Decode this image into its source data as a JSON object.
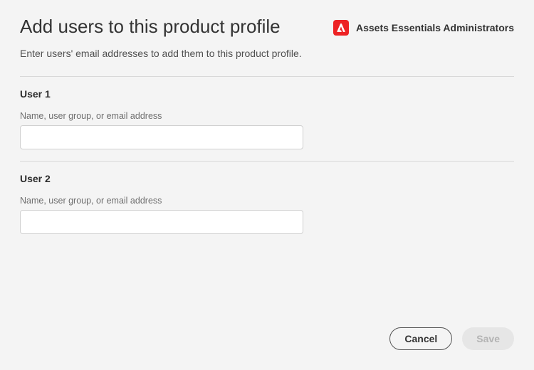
{
  "header": {
    "title": "Add users to this product profile",
    "product_name": "Assets Essentials Administrators"
  },
  "subtitle": "Enter users' email addresses to add them to this product profile.",
  "users": [
    {
      "label": "User 1",
      "field_label": "Name, user group, or email address",
      "value": ""
    },
    {
      "label": "User 2",
      "field_label": "Name, user group, or email address",
      "value": ""
    }
  ],
  "buttons": {
    "cancel": "Cancel",
    "save": "Save"
  }
}
